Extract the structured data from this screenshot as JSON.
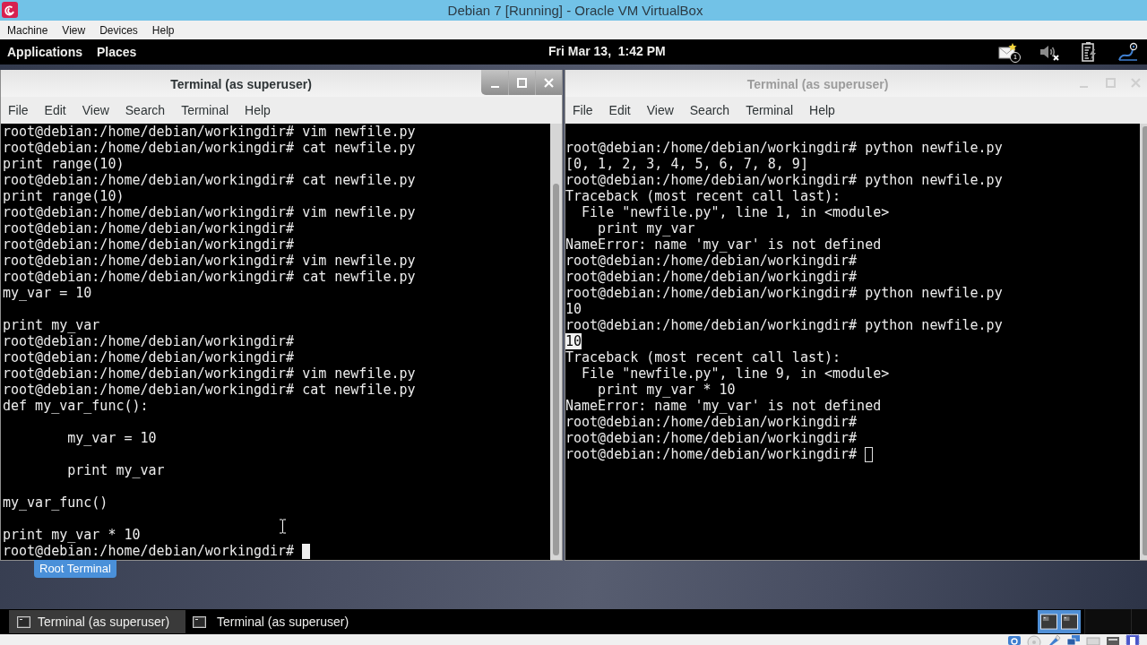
{
  "vbox_window": {
    "title": "Debian 7 [Running] - Oracle VM VirtualBox"
  },
  "vbox_menu": [
    "Machine",
    "View",
    "Devices",
    "Help"
  ],
  "top_panel": {
    "menus": [
      "Applications",
      "Places"
    ],
    "clock": "Fri Mar 13,  1:42 PM",
    "mail_badge": "1",
    "volume_muted": true
  },
  "terminals": [
    {
      "title": "Terminal (as superuser)",
      "focused": true,
      "menu": [
        "File",
        "Edit",
        "View",
        "Search",
        "Terminal",
        "Help"
      ],
      "lines": [
        {
          "kind": "text",
          "text": "root@debian:/home/debian/workingdir# vim newfile.py"
        },
        {
          "kind": "text",
          "text": "root@debian:/home/debian/workingdir# cat newfile.py"
        },
        {
          "kind": "text",
          "text": "print range(10)"
        },
        {
          "kind": "text",
          "text": "root@debian:/home/debian/workingdir# cat newfile.py"
        },
        {
          "kind": "text",
          "text": "print range(10)"
        },
        {
          "kind": "text",
          "text": "root@debian:/home/debian/workingdir# vim newfile.py"
        },
        {
          "kind": "text",
          "text": "root@debian:/home/debian/workingdir#"
        },
        {
          "kind": "text",
          "text": "root@debian:/home/debian/workingdir#"
        },
        {
          "kind": "text",
          "text": "root@debian:/home/debian/workingdir# vim newfile.py"
        },
        {
          "kind": "text",
          "text": "root@debian:/home/debian/workingdir# cat newfile.py"
        },
        {
          "kind": "text",
          "text": "my_var = 10"
        },
        {
          "kind": "blank"
        },
        {
          "kind": "text",
          "text": "print my_var"
        },
        {
          "kind": "text",
          "text": "root@debian:/home/debian/workingdir#"
        },
        {
          "kind": "text",
          "text": "root@debian:/home/debian/workingdir#"
        },
        {
          "kind": "text",
          "text": "root@debian:/home/debian/workingdir# vim newfile.py"
        },
        {
          "kind": "text",
          "text": "root@debian:/home/debian/workingdir# cat newfile.py"
        },
        {
          "kind": "text",
          "text": "def my_var_func():"
        },
        {
          "kind": "blank"
        },
        {
          "kind": "text",
          "text": "        my_var = 10"
        },
        {
          "kind": "blank"
        },
        {
          "kind": "text",
          "text": "        print my_var"
        },
        {
          "kind": "blank"
        },
        {
          "kind": "text",
          "text": "my_var_func()"
        },
        {
          "kind": "blank"
        },
        {
          "kind": "text",
          "text": "print my_var * 10"
        },
        {
          "kind": "text",
          "text": "root@debian:/home/debian/workingdir#"
        }
      ]
    },
    {
      "title": "Terminal (as superuser)",
      "focused": false,
      "menu": [
        "File",
        "Edit",
        "View",
        "Search",
        "Terminal",
        "Help"
      ],
      "lines": [
        {
          "kind": "blank"
        },
        {
          "kind": "text",
          "text": "root@debian:/home/debian/workingdir# python newfile.py"
        },
        {
          "kind": "text",
          "text": "[0, 1, 2, 3, 4, 5, 6, 7, 8, 9]"
        },
        {
          "kind": "text",
          "text": "root@debian:/home/debian/workingdir# python newfile.py"
        },
        {
          "kind": "text",
          "text": "Traceback (most recent call last):"
        },
        {
          "kind": "text",
          "text": "  File \"newfile.py\", line 1, in <module>"
        },
        {
          "kind": "text",
          "text": "    print my_var"
        },
        {
          "kind": "text",
          "text": "NameError: name 'my_var' is not defined"
        },
        {
          "kind": "text",
          "text": "root@debian:/home/debian/workingdir#"
        },
        {
          "kind": "text",
          "text": "root@debian:/home/debian/workingdir#"
        },
        {
          "kind": "text",
          "text": "root@debian:/home/debian/workingdir# python newfile.py"
        },
        {
          "kind": "text",
          "text": "10"
        },
        {
          "kind": "text",
          "text": "root@debian:/home/debian/workingdir# python newfile.py"
        },
        {
          "kind": "highlight",
          "text": "10"
        },
        {
          "kind": "text",
          "text": "Traceback (most recent call last):"
        },
        {
          "kind": "text",
          "text": "  File \"newfile.py\", line 9, in <module>"
        },
        {
          "kind": "text",
          "text": "    print my_var * 10"
        },
        {
          "kind": "text",
          "text": "NameError: name 'my_var' is not defined"
        },
        {
          "kind": "text",
          "text": "root@debian:/home/debian/workingdir#"
        },
        {
          "kind": "text",
          "text": "root@debian:/home/debian/workingdir#"
        },
        {
          "kind": "text",
          "text": "root@debian:/home/debian/workingdir#"
        }
      ]
    }
  ],
  "tooltip": "Root Terminal",
  "taskbar": [
    {
      "label": "Terminal (as superuser)",
      "selected": true
    },
    {
      "label": "Terminal (as superuser)",
      "selected": false
    }
  ]
}
